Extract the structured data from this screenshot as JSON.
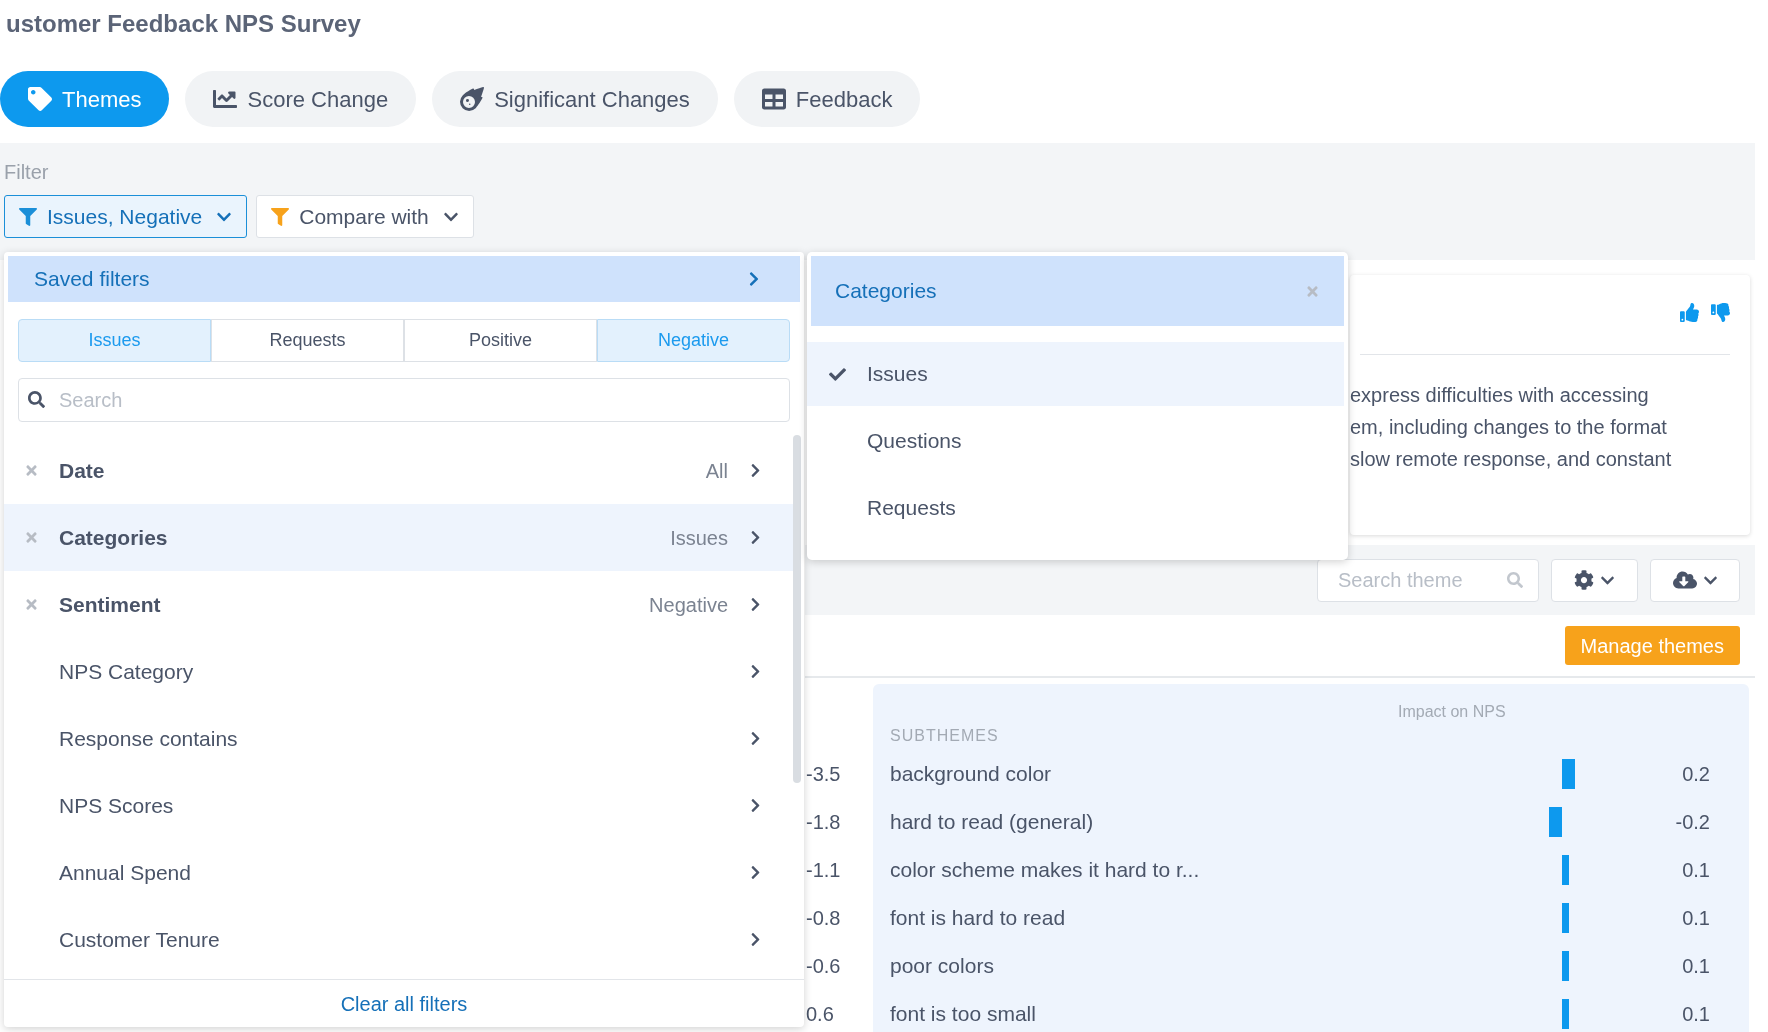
{
  "title": "ustomer Feedback NPS Survey",
  "tabs": [
    {
      "label": "Themes",
      "selected": true
    },
    {
      "label": "Score Change",
      "selected": false
    },
    {
      "label": "Significant Changes",
      "selected": false
    },
    {
      "label": "Feedback",
      "selected": false
    }
  ],
  "filter": {
    "label": "Filter",
    "buttons": [
      {
        "label": "Issues, Negative",
        "kind": "active"
      },
      {
        "label": "Compare with",
        "kind": "compare"
      }
    ]
  },
  "filter_menu": {
    "header": "Saved filters",
    "segments": [
      {
        "label": "Issues",
        "selected": true
      },
      {
        "label": "Requests",
        "selected": false
      },
      {
        "label": "Positive",
        "selected": false
      },
      {
        "label": "Negative",
        "selected": true
      }
    ],
    "search": {
      "placeholder": "Search"
    },
    "rows": [
      {
        "label": "Date",
        "value": "All",
        "applied": true,
        "selected": false
      },
      {
        "label": "Categories",
        "value": "Issues",
        "applied": true,
        "selected": true
      },
      {
        "label": "Sentiment",
        "value": "Negative",
        "applied": true,
        "selected": false
      },
      {
        "label": "NPS Category",
        "applied": false,
        "selected": false
      },
      {
        "label": "Response contains",
        "applied": false,
        "selected": false
      },
      {
        "label": "NPS Scores",
        "applied": false,
        "selected": false
      },
      {
        "label": "Annual Spend",
        "applied": false,
        "selected": false
      },
      {
        "label": "Customer Tenure",
        "applied": false,
        "selected": false
      }
    ],
    "footer": "Clear all filters"
  },
  "categories_menu": {
    "title": "Categories",
    "items": [
      {
        "label": "Issues",
        "checked": true
      },
      {
        "label": "Questions",
        "checked": false
      },
      {
        "label": "Requests",
        "checked": false
      }
    ]
  },
  "summary_card": {
    "lines": [
      "express difficulties with accessing",
      "em, including changes to the format",
      "slow remote response, and constant"
    ]
  },
  "toolbar": {
    "search": {
      "placeholder": "Search theme"
    }
  },
  "manage_button": "Manage themes",
  "table": {
    "column_1": [
      "-3.5",
      "-1.8",
      "-1.1",
      "-0.8",
      "-0.6",
      "0.6"
    ],
    "subthemes": {
      "impact_heading": "Impact on NPS",
      "heading": "SUBTHEMES",
      "rows": [
        {
          "label": "background color",
          "value": "0.2"
        },
        {
          "label": "hard to read (general)",
          "value": "-0.2"
        },
        {
          "label": "color scheme makes it hard to r...",
          "value": "0.1"
        },
        {
          "label": "font is hard to read",
          "value": "0.1"
        },
        {
          "label": "poor colors",
          "value": "0.1"
        },
        {
          "label": "font is too small",
          "value": "0.1"
        }
      ]
    }
  }
}
